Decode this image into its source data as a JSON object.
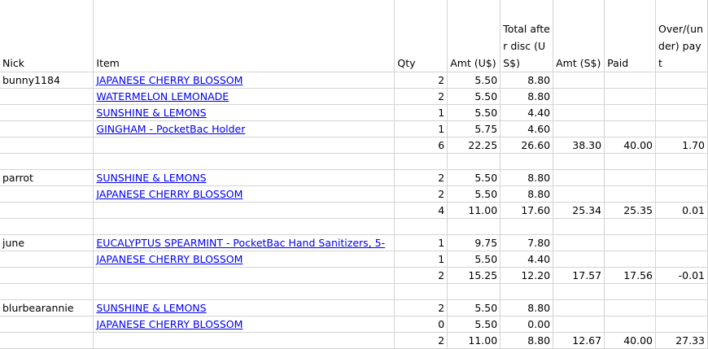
{
  "headers": {
    "nick": "Nick",
    "item": "Item",
    "qty": "Qty",
    "amt_usd": "Amt (U$)",
    "total_after_disc": "Total after disc (US$)",
    "amt_sgd": "Amt (S$)",
    "paid": "Paid",
    "over_under": "Over/(under) payt"
  },
  "rows": [
    {
      "type": "item",
      "nick": "bunny1184",
      "item": "JAPANESE CHERRY BLOSSOM",
      "qty": "2",
      "amt": "5.50",
      "total": "8.80"
    },
    {
      "type": "item",
      "nick": "",
      "item": "WATERMELON LEMONADE",
      "qty": "2",
      "amt": "5.50",
      "total": "8.80"
    },
    {
      "type": "item",
      "nick": "",
      "item": "SUNSHINE & LEMONS",
      "qty": "1",
      "amt": "5.50",
      "total": "4.40"
    },
    {
      "type": "item",
      "nick": "",
      "item": "GINGHAM - PocketBac Holder",
      "qty": "1",
      "amt": "5.75",
      "total": "4.60"
    },
    {
      "type": "total",
      "qty": "6",
      "amt": "22.25",
      "total": "26.60",
      "sgd": "38.30",
      "paid": "40.00",
      "over": "1.70"
    },
    {
      "type": "blank"
    },
    {
      "type": "item",
      "nick": "parrot",
      "item": "SUNSHINE & LEMONS",
      "qty": "2",
      "amt": "5.50",
      "total": "8.80"
    },
    {
      "type": "item",
      "nick": "",
      "item": "JAPANESE CHERRY BLOSSOM",
      "qty": "2",
      "amt": "5.50",
      "total": "8.80"
    },
    {
      "type": "total",
      "qty": "4",
      "amt": "11.00",
      "total": "17.60",
      "sgd": "25.34",
      "paid": "25.35",
      "over": "0.01"
    },
    {
      "type": "blank"
    },
    {
      "type": "item",
      "nick": "june",
      "item": "EUCALYPTUS SPEARMINT - PocketBac Hand Sanitizers, 5-",
      "qty": "1",
      "amt": "9.75",
      "total": "7.80"
    },
    {
      "type": "item",
      "nick": "",
      "item": "JAPANESE CHERRY BLOSSOM",
      "qty": "1",
      "amt": "5.50",
      "total": "4.40"
    },
    {
      "type": "total",
      "qty": "2",
      "amt": "15.25",
      "total": "12.20",
      "sgd": "17.57",
      "paid": "17.56",
      "over": "-0.01"
    },
    {
      "type": "blank"
    },
    {
      "type": "item",
      "nick": "blurbearannie",
      "item": "SUNSHINE & LEMONS",
      "qty": "2",
      "amt": "5.50",
      "total": "8.80"
    },
    {
      "type": "item",
      "nick": "",
      "item": "JAPANESE CHERRY BLOSSOM",
      "qty": "0",
      "amt": "5.50",
      "total": "0.00"
    },
    {
      "type": "total",
      "qty": "2",
      "amt": "11.00",
      "total": "8.80",
      "sgd": "12.67",
      "paid": "40.00",
      "over": "27.33"
    }
  ]
}
